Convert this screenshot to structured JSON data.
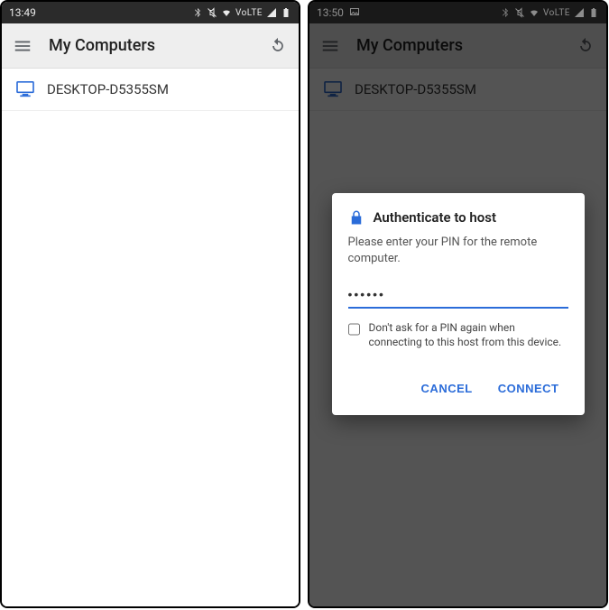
{
  "left": {
    "statusbar": {
      "time": "13:49"
    },
    "appbar": {
      "title": "My Computers"
    },
    "list": {
      "items": [
        {
          "name": "DESKTOP-D5355SM"
        }
      ]
    }
  },
  "right": {
    "statusbar": {
      "time": "13:50"
    },
    "appbar": {
      "title": "My Computers"
    },
    "list": {
      "items": [
        {
          "name": "DESKTOP-D5355SM"
        }
      ]
    },
    "dialog": {
      "title": "Authenticate to host",
      "body": "Please enter your PIN for the remote computer.",
      "pin_value": "••••••",
      "checkbox_label": "Don't ask for a PIN again when connecting to this host from this device.",
      "cancel": "CANCEL",
      "connect": "CONNECT"
    }
  }
}
